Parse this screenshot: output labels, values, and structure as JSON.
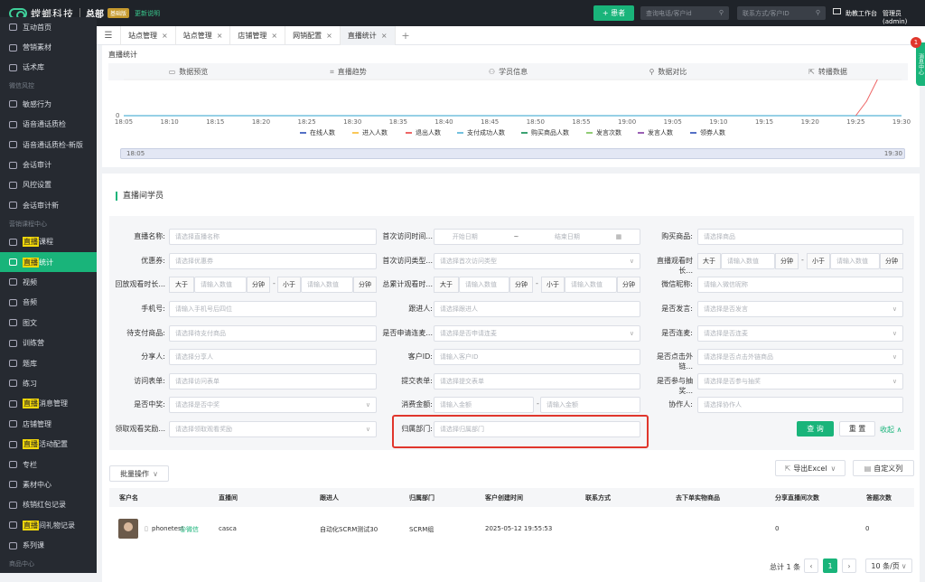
{
  "topbar": {
    "brand": "螳螂科技",
    "org": "总部",
    "version": "基础版",
    "update": "更新说明",
    "add_button": "+ 患者",
    "search_phone_placeholder": "查询电话/客户id",
    "search_contact_placeholder": "联系方式/客户ID",
    "workbench": "助教工作台",
    "user": "管理员(admin)"
  },
  "sidebar": {
    "items": [
      {
        "type": "item",
        "label": "互动首页",
        "name": "sidebar-item-interaction-home"
      },
      {
        "type": "item",
        "label": "营销素材",
        "name": "sidebar-item-marketing-material"
      },
      {
        "type": "item",
        "label": "话术库",
        "name": "sidebar-item-script-library"
      },
      {
        "type": "section",
        "label": "微信风控"
      },
      {
        "type": "item",
        "label": "敏感行为",
        "name": "sidebar-item-sensitive-behavior"
      },
      {
        "type": "item",
        "label": "语音通话质检",
        "name": "sidebar-item-voice-qc"
      },
      {
        "type": "item",
        "label": "语音通话质检-新版",
        "name": "sidebar-item-voice-qc-new"
      },
      {
        "type": "item",
        "label": "会话审计",
        "name": "sidebar-item-session-audit"
      },
      {
        "type": "item",
        "label": "风控设置",
        "name": "sidebar-item-risk-settings"
      },
      {
        "type": "item",
        "label": "会话审计新",
        "name": "sidebar-item-session-audit-new"
      },
      {
        "type": "section",
        "label": "营销课程中心"
      },
      {
        "type": "item",
        "hl": "直播",
        "label": "课程",
        "name": "sidebar-item-live-course"
      },
      {
        "type": "item",
        "hl": "直播",
        "label": "统计",
        "name": "sidebar-item-live-stats",
        "active": true
      },
      {
        "type": "item",
        "label": "视频",
        "name": "sidebar-item-video"
      },
      {
        "type": "item",
        "label": "音频",
        "name": "sidebar-item-audio"
      },
      {
        "type": "item",
        "label": "图文",
        "name": "sidebar-item-article"
      },
      {
        "type": "item",
        "label": "训练营",
        "name": "sidebar-item-camp"
      },
      {
        "type": "item",
        "label": "题库",
        "name": "sidebar-item-question-bank"
      },
      {
        "type": "item",
        "label": "练习",
        "name": "sidebar-item-practice"
      },
      {
        "type": "item",
        "hl": "直播",
        "label": "消息管理",
        "name": "sidebar-item-live-messages"
      },
      {
        "type": "item",
        "label": "店铺管理",
        "name": "sidebar-item-shop"
      },
      {
        "type": "item",
        "hl": "直播",
        "label": "活动配置",
        "name": "sidebar-item-live-activity"
      },
      {
        "type": "item",
        "label": "专栏",
        "name": "sidebar-item-column"
      },
      {
        "type": "item",
        "label": "素材中心",
        "name": "sidebar-item-material-center"
      },
      {
        "type": "item",
        "label": "核销红包记录",
        "name": "sidebar-item-redpacket"
      },
      {
        "type": "item",
        "hl": "直播",
        "label": "间礼物记录",
        "name": "sidebar-item-live-gifts"
      },
      {
        "type": "item",
        "label": "系列课",
        "name": "sidebar-item-series"
      },
      {
        "type": "section",
        "label": "商品中心"
      }
    ]
  },
  "tabs": [
    {
      "label": "站点管理"
    },
    {
      "label": "站点管理"
    },
    {
      "label": "店铺管理"
    },
    {
      "label": "网销配置"
    },
    {
      "label": "直播统计",
      "active": true
    }
  ],
  "page": {
    "breadcrumb": "直播统计",
    "section_title": "直播间学员"
  },
  "stat_tabs": [
    {
      "icon": "▭",
      "label": "数据预览",
      "name": "tab-data-preview"
    },
    {
      "icon": "⌗",
      "label": "直播趋势",
      "name": "tab-live-trend"
    },
    {
      "icon": "⚇",
      "label": "学员信息",
      "name": "tab-student-info"
    },
    {
      "icon": "⚲",
      "label": "数据对比",
      "name": "tab-data-compare"
    },
    {
      "icon": "⇱",
      "label": "转播数据",
      "name": "tab-relay-data"
    }
  ],
  "chart_data": {
    "type": "line",
    "x": [
      "18:05",
      "18:10",
      "18:15",
      "18:20",
      "18:25",
      "18:30",
      "18:35",
      "18:40",
      "18:45",
      "18:50",
      "18:55",
      "19:00",
      "19:05",
      "19:10",
      "19:15",
      "19:20",
      "19:25",
      "19:30"
    ],
    "y_tick": "0",
    "series": [
      {
        "name": "在线人数",
        "color": "#5470c6"
      },
      {
        "name": "进入人数",
        "color": "#fac858"
      },
      {
        "name": "退出人数",
        "color": "#ee6666"
      },
      {
        "name": "支付成功人数",
        "color": "#73c0de"
      },
      {
        "name": "购买商品人数",
        "color": "#3ba272"
      },
      {
        "name": "发言次数",
        "color": "#91cc75"
      },
      {
        "name": "发言人数",
        "color": "#9a60b4"
      },
      {
        "name": "领券人数",
        "color": "#5470c6"
      }
    ],
    "zoom_start": "18:05",
    "zoom_end": "19:30"
  },
  "filters": {
    "live_name": {
      "label": "直播名称:",
      "ph": "请选择直播名称"
    },
    "first_visit_time": {
      "label": "首次访问时间...",
      "start": "开始日期",
      "end": "结束日期",
      "sep": "~"
    },
    "purchase_goods": {
      "label": "购买商品:",
      "ph": "请选择商品"
    },
    "coupon": {
      "label": "优惠券:",
      "ph": "请选择优惠券"
    },
    "first_visit_type": {
      "label": "首次访问类型...",
      "ph": "请选择首次访问类型"
    },
    "live_watch_time": {
      "label": "直播观看时长...",
      "gt": "大于",
      "lt": "小于",
      "ph": "请输入数值",
      "unit": "分钟"
    },
    "replay_watch_time": {
      "label": "回放观看时长...",
      "gt": "大于",
      "lt": "小于",
      "ph": "请输入数值",
      "unit": "分钟"
    },
    "total_watch_time": {
      "label": "总累计观看时...",
      "gt": "大于",
      "lt": "小于",
      "ph": "请输入数值",
      "unit": "分钟"
    },
    "wechat_nick": {
      "label": "微信昵称:",
      "ph": "请输入微信昵称"
    },
    "phone": {
      "label": "手机号:",
      "ph": "请输入手机号后四位"
    },
    "follower": {
      "label": "跟进人:",
      "ph": "请选择跟进人"
    },
    "spoke": {
      "label": "是否发言:",
      "ph": "请选择是否发言"
    },
    "pending_goods": {
      "label": "待支付商品:",
      "ph": "请选择待支付商品"
    },
    "applied_cs": {
      "label": "是否申请连麦...",
      "ph": "请选择是否申请连麦"
    },
    "connected": {
      "label": "是否连麦:",
      "ph": "请选择是否连麦"
    },
    "sharer": {
      "label": "分享人:",
      "ph": "请选择分享人"
    },
    "customer_id": {
      "label": "客户ID:",
      "ph": "请输入客户ID"
    },
    "clicked_link": {
      "label": "是否点击外链...",
      "ph": "请选择是否点击外链商品"
    },
    "visit_form": {
      "label": "访问表单:",
      "ph": "请选择访问表单"
    },
    "submit_form": {
      "label": "提交表单:",
      "ph": "请选择提交表单"
    },
    "lottery": {
      "label": "是否参与抽奖...",
      "ph": "请选择是否参与抽奖"
    },
    "won": {
      "label": "是否中奖:",
      "ph": "请选择是否中奖"
    },
    "amount": {
      "label": "消费金额:",
      "ph": "请输入金额",
      "sep": "-"
    },
    "collaborator": {
      "label": "协作人:",
      "ph": "请选择协作人"
    },
    "watch_reward": {
      "label": "领取观看奖励...",
      "ph": "请选择领取观看奖励"
    },
    "department": {
      "label": "归属部门:",
      "ph": "请选择归属部门"
    }
  },
  "actions": {
    "query": "查 询",
    "reset": "重 置",
    "collapse": "收起 ∧",
    "batch": "批量操作",
    "export": "导出Excel",
    "custom_cols": "自定义列"
  },
  "table": {
    "headers": [
      "客户名",
      "直播间",
      "跟进人",
      "归属部门",
      "客户创建时间",
      "联系方式",
      "去下单实物商品",
      "分享直播间次数",
      "答题次数"
    ],
    "row": {
      "name": "phonetest",
      "source": "@微信",
      "live_room": "casca",
      "follower": "自动化SCRM测试30",
      "department": "SCRM组",
      "created": "2025-05-12 19:55:53",
      "shares": "0",
      "answers": "0"
    }
  },
  "pager": {
    "total": "总计 1 条",
    "page": "1",
    "size": "10 条/页"
  },
  "float": {
    "badge": "1",
    "label": "消息中心"
  }
}
